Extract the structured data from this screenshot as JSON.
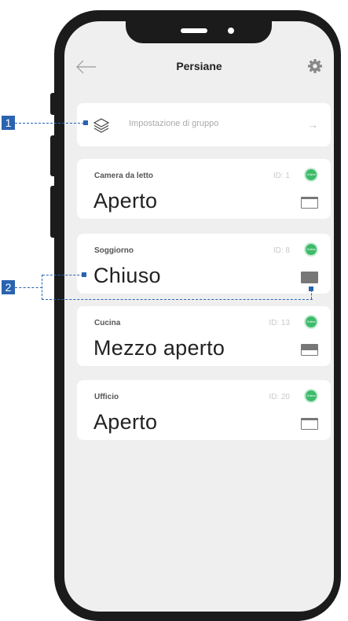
{
  "header": {
    "title": "Persiane",
    "back_icon": "arrow-left-icon",
    "settings_icon": "gear-icon"
  },
  "group": {
    "label": "Impostazione di gruppo",
    "icon": "layers-icon",
    "arrow": "→"
  },
  "rooms": [
    {
      "name": "Camera da letto",
      "id": "ID: 1",
      "status": "Online",
      "state": "Aperto",
      "shutter_closed_fraction": 0.1
    },
    {
      "name": "Soggiorno",
      "id": "ID: 8",
      "status": "Online",
      "state": "Chiuso",
      "shutter_closed_fraction": 1.0
    },
    {
      "name": "Cucina",
      "id": "ID: 13",
      "status": "Online",
      "state": "Mezzo aperto",
      "shutter_closed_fraction": 0.5
    },
    {
      "name": "Ufficio",
      "id": "ID: 20",
      "status": "Online",
      "state": "Aperto",
      "shutter_closed_fraction": 0.1
    }
  ],
  "callouts": [
    "1",
    "2"
  ],
  "colors": {
    "accent": "#2a63b0",
    "online": "#3dbb6a",
    "screen_bg": "#efefef"
  }
}
